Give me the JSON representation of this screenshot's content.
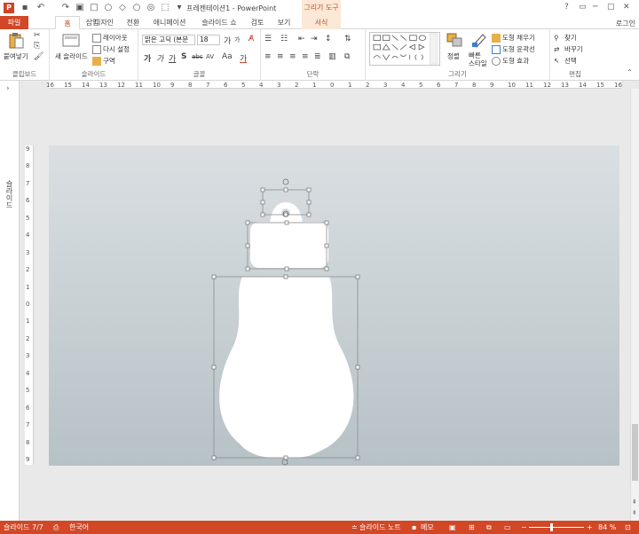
{
  "app": {
    "window_title": "프레젠테이션1 - PowerPoint",
    "contextual_tab_group": "그리기 도구",
    "signin_label": "로그인",
    "window_controls": [
      "?",
      "▭",
      "─",
      "▢",
      "✕"
    ]
  },
  "tabs": [
    {
      "label": "파일"
    },
    {
      "label": "홈"
    },
    {
      "label": "삽입"
    },
    {
      "label": "디자인"
    },
    {
      "label": "전환"
    },
    {
      "label": "애니메이션"
    },
    {
      "label": "슬라이드 쇼"
    },
    {
      "label": "검토"
    },
    {
      "label": "보기"
    },
    {
      "label": "서식"
    }
  ],
  "ribbon": {
    "clipboard": {
      "paste_label": "붙여넣기",
      "group_label": "클립보드"
    },
    "slides": {
      "new_slide_label": "새 슬라이드",
      "layout_label": "레이아웃",
      "reset_label": "다시 설정",
      "section_label": "구역",
      "group_label": "슬라이드"
    },
    "font": {
      "font_name": "맑은 고딕 (본문",
      "font_size": "18",
      "group_label": "글꼴",
      "grow_glyph": "가",
      "shrink_glyph": "가",
      "bold_glyph": "가",
      "italic_glyph": "가",
      "underline_glyph": "가",
      "shadow_glyph": "S",
      "strike_glyph": "abc",
      "spacing_glyph": "AV",
      "case_glyph": "Aa",
      "color_glyph": "가"
    },
    "paragraph": {
      "group_label": "단락"
    },
    "drawing": {
      "arrange_label": "정렬",
      "quick_styles_label": "빠른 스타일",
      "fill_label": "도형 채우기",
      "outline_label": "도형 윤곽선",
      "effects_label": "도형 효과",
      "group_label": "그리기"
    },
    "editing": {
      "find_label": "찾기",
      "replace_label": "바꾸기",
      "select_label": "선택",
      "group_label": "편집"
    }
  },
  "ruler": {
    "horizontal_ticks": [
      "16",
      "15",
      "14",
      "13",
      "12",
      "11",
      "10",
      "9",
      "8",
      "7",
      "6",
      "5",
      "4",
      "3",
      "2",
      "1",
      "0",
      "1",
      "2",
      "3",
      "4",
      "5",
      "6",
      "7",
      "8",
      "9",
      "10",
      "11",
      "12",
      "13",
      "14",
      "15",
      "16"
    ],
    "vertical_ticks": [
      "9",
      "8",
      "7",
      "6",
      "5",
      "4",
      "3",
      "2",
      "1",
      "0",
      "1",
      "2",
      "3",
      "4",
      "5",
      "6",
      "7",
      "8",
      "9"
    ]
  },
  "thumbnail_pane": {
    "label": "슬라이드"
  },
  "status": {
    "slide_indicator": "슬라이드 7/7",
    "language": "한국어",
    "notes_label": "슬라이드 노트",
    "comments_label": "메모",
    "zoom_percent": "84 %",
    "zoom_level": 0.84
  },
  "colors": {
    "accent": "#d24726",
    "contextual_tab": "#fbe8d6",
    "slide_top": "#dadfe2",
    "slide_bottom": "#b7c2c6",
    "shape_fill": "#ffffff"
  }
}
